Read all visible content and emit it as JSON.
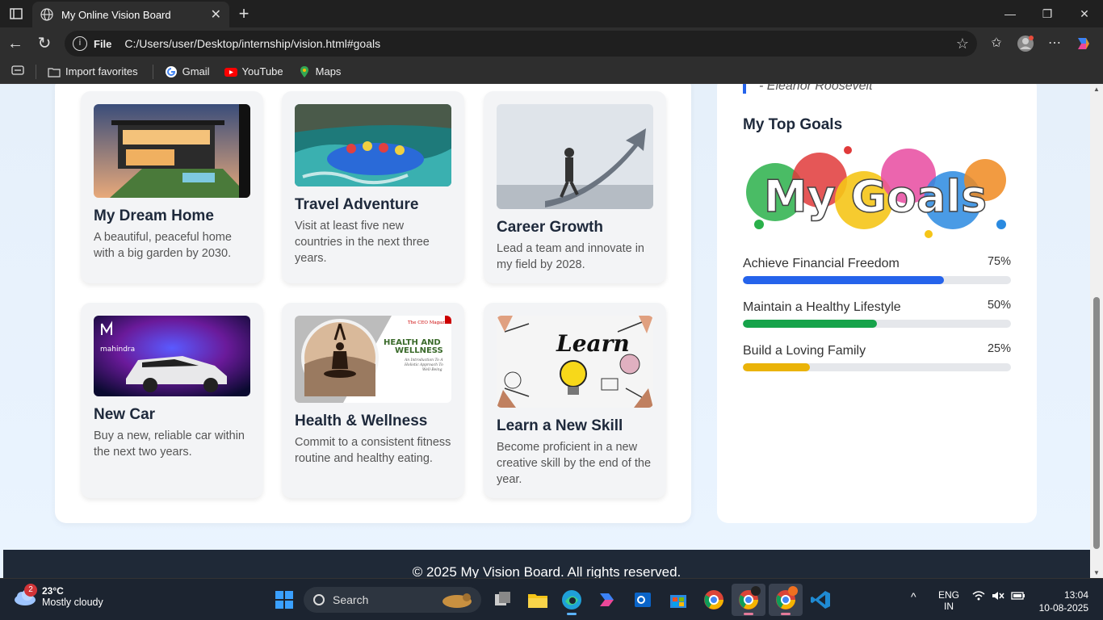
{
  "browser": {
    "tab_title": "My Online Vision Board",
    "url_scheme": "File",
    "url": "C:/Users/user/Desktop/internship/vision.html#goals",
    "favorites": [
      "Import favorites",
      "Gmail",
      "YouTube",
      "Maps"
    ]
  },
  "page": {
    "cards": [
      {
        "title": "My Dream Home",
        "desc": "A beautiful, peaceful home with a big garden by 2030.",
        "image": "modern-house-photo"
      },
      {
        "title": "Travel Adventure",
        "desc": "Visit at least five new countries in the next three years.",
        "image": "rafting-photo"
      },
      {
        "title": "Career Growth",
        "desc": "Lead a team and innovate in my field by 2028.",
        "image": "man-walking-up-arrow-photo"
      },
      {
        "title": "New Car",
        "desc": "Buy a new, reliable car within the next two years.",
        "image": "mahindra-suv-photo"
      },
      {
        "title": "Health & Wellness",
        "desc": "Commit to a consistent fitness routine and healthy eating.",
        "image": "yoga-meditation-photo"
      },
      {
        "title": "Learn a New Skill",
        "desc": "Become proficient in a new creative skill by the end of the year.",
        "image": "learn-doodle-photo"
      }
    ],
    "quote_author": "- Eleanor Roosevelt",
    "goals_title": "My Top Goals",
    "goals_logo_text": "My Goals",
    "health_img_text": {
      "brand": "The CEO Magazine",
      "headline": "HEALTH AND WELLNESS",
      "sub": "An Introduction To A Holistic Approach To Well-Being"
    },
    "car_img_text": {
      "brand": "mahindra"
    },
    "learn_img_text": "Learn",
    "goals": [
      {
        "label": "Achieve Financial Freedom",
        "pct": "75%",
        "value": 0.75,
        "color": "#2563eb"
      },
      {
        "label": "Maintain a Healthy Lifestyle",
        "pct": "50%",
        "value": 0.5,
        "color": "#16a34a"
      },
      {
        "label": "Build a Loving Family",
        "pct": "25%",
        "value": 0.25,
        "color": "#eab308"
      }
    ],
    "footer": "© 2025 My Vision Board. All rights reserved."
  },
  "taskbar": {
    "weather_temp": "23°C",
    "weather_cond": "Mostly cloudy",
    "weather_badge": "2",
    "search_label": "Search",
    "lang": "ENG",
    "region": "IN",
    "time": "13:04",
    "date": "10-08-2025"
  }
}
